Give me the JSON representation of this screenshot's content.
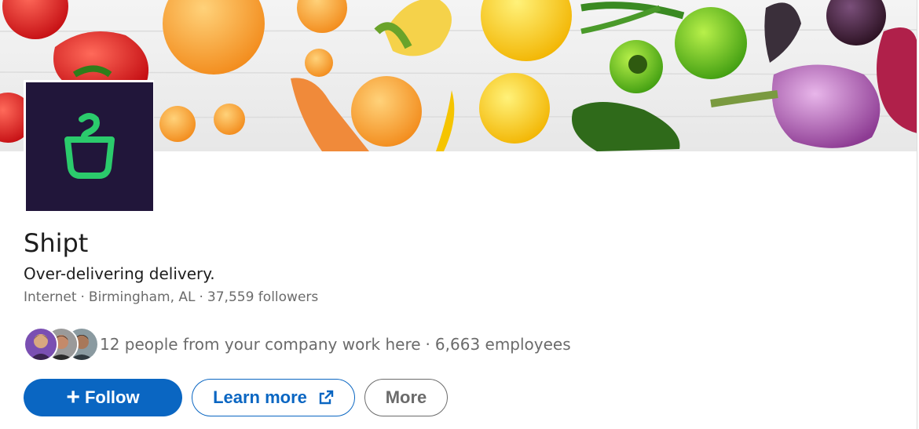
{
  "company": {
    "name": "Shipt",
    "tagline": "Over-delivering delivery.",
    "industry": "Internet",
    "location": "Birmingham, AL",
    "followers": "37,559 followers",
    "logo_color": "#21163a",
    "logo_accent": "#2bcb6c"
  },
  "insights": {
    "company_people": "12 people from your company work here",
    "employees": "6,663 employees"
  },
  "actions": {
    "follow": "Follow",
    "learn_more": "Learn more",
    "more": "More"
  },
  "colors": {
    "primary": "#0a66c2",
    "text": "#1d1d1d",
    "muted": "#6b6b6b"
  },
  "icons": {
    "follow": "plus-icon",
    "learn_more": "external-link-icon"
  }
}
